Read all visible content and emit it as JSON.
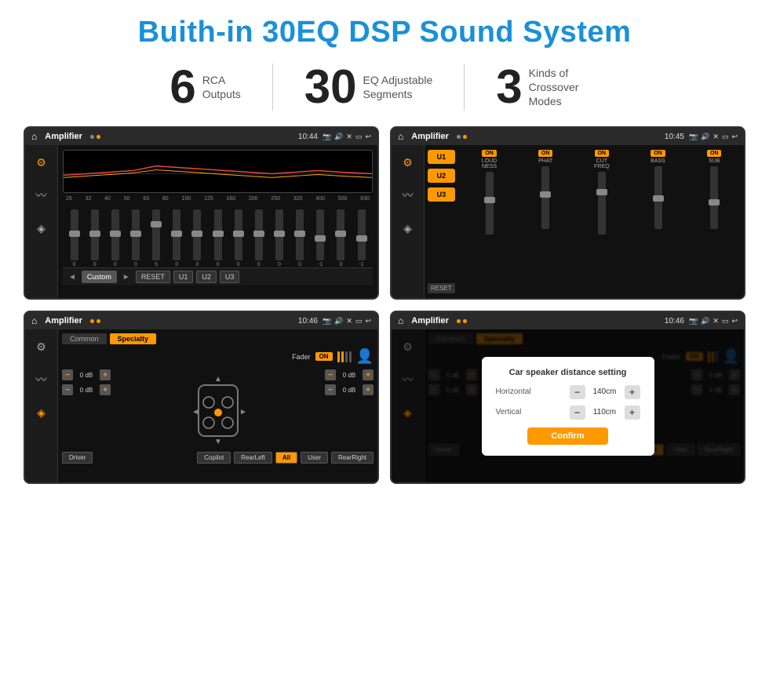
{
  "header": {
    "title": "Buith-in 30EQ DSP Sound System"
  },
  "stats": [
    {
      "number": "6",
      "label": "RCA\nOutputs"
    },
    {
      "number": "30",
      "label": "EQ Adjustable\nSegments"
    },
    {
      "number": "3",
      "label": "Kinds of\nCrossover Modes"
    }
  ],
  "screens": [
    {
      "id": "eq-screen",
      "statusBar": {
        "appName": "Amplifier",
        "time": "10:44"
      },
      "type": "eq"
    },
    {
      "id": "dsp-screen",
      "statusBar": {
        "appName": "Amplifier",
        "time": "10:45"
      },
      "type": "dsp"
    },
    {
      "id": "fader-screen",
      "statusBar": {
        "appName": "Amplifier",
        "time": "10:46"
      },
      "type": "fader"
    },
    {
      "id": "dialog-screen",
      "statusBar": {
        "appName": "Amplifier",
        "time": "10:46"
      },
      "type": "dialog"
    }
  ],
  "eq": {
    "freqs": [
      "25",
      "32",
      "40",
      "50",
      "63",
      "80",
      "100",
      "125",
      "160",
      "200",
      "250",
      "320",
      "400",
      "500",
      "630"
    ],
    "values": [
      "0",
      "0",
      "0",
      "0",
      "5",
      "0",
      "0",
      "0",
      "0",
      "0",
      "0",
      "0",
      "-1",
      "0",
      "-1"
    ],
    "buttons": [
      "Custom",
      "RESET",
      "U1",
      "U2",
      "U3"
    ]
  },
  "dsp": {
    "uButtons": [
      "U1",
      "U2",
      "U3"
    ],
    "resetBtn": "RESET",
    "channels": [
      {
        "label": "LOUDNESS",
        "on": true
      },
      {
        "label": "PHAT",
        "on": true
      },
      {
        "label": "CUT FREQ",
        "on": true
      },
      {
        "label": "BASS",
        "on": true
      },
      {
        "label": "SUB",
        "on": true
      }
    ]
  },
  "fader": {
    "tabs": [
      "Common",
      "Specialty"
    ],
    "faderLabel": "Fader",
    "faderOn": "ON",
    "dbControls": [
      {
        "value": "0 dB"
      },
      {
        "value": "0 dB"
      },
      {
        "value": "0 dB"
      },
      {
        "value": "0 dB"
      }
    ],
    "buttons": [
      "Driver",
      "",
      "",
      "",
      "Copilot",
      "RearLeft",
      "All",
      "",
      "User",
      "RearRight"
    ]
  },
  "dialog": {
    "title": "Car speaker distance setting",
    "horizontalLabel": "Horizontal",
    "horizontalValue": "140cm",
    "verticalLabel": "Vertical",
    "verticalValue": "110cm",
    "confirmLabel": "Confirm"
  }
}
